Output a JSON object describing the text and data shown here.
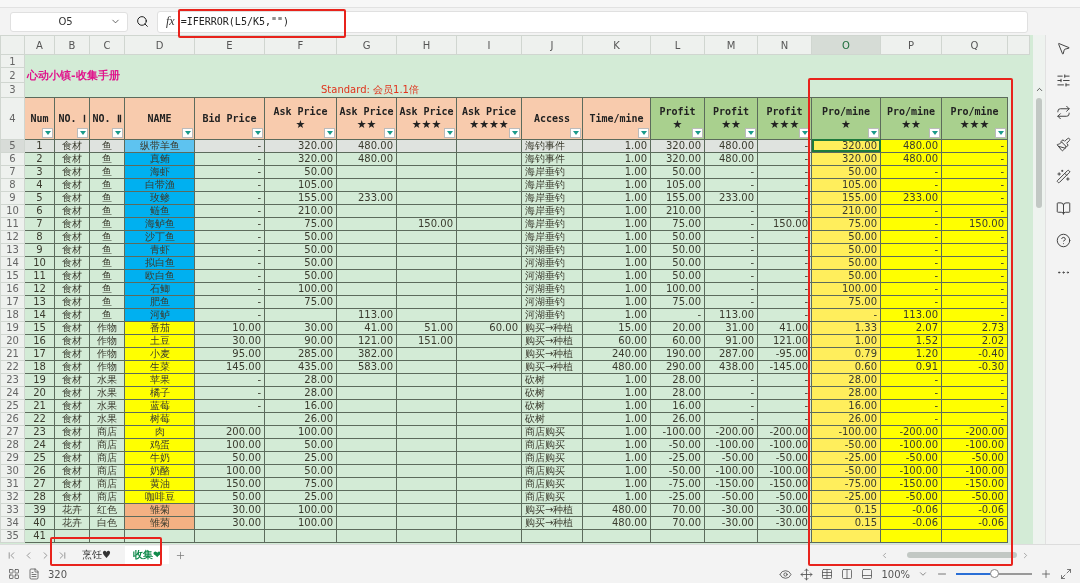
{
  "formula_bar": {
    "cell_ref": "O5",
    "function_label": "fx",
    "formula": "=IFERROR(L5/K5,\"\")"
  },
  "columns": [
    {
      "letter": "A",
      "selected": false
    },
    {
      "letter": "B",
      "selected": false
    },
    {
      "letter": "C",
      "selected": false
    },
    {
      "letter": "D",
      "selected": false
    },
    {
      "letter": "E",
      "selected": false
    },
    {
      "letter": "F",
      "selected": false
    },
    {
      "letter": "G",
      "selected": false
    },
    {
      "letter": "H",
      "selected": false
    },
    {
      "letter": "I",
      "selected": false
    },
    {
      "letter": "J",
      "selected": false
    },
    {
      "letter": "K",
      "selected": false
    },
    {
      "letter": "L",
      "selected": false
    },
    {
      "letter": "M",
      "selected": false
    },
    {
      "letter": "N",
      "selected": false
    },
    {
      "letter": "O",
      "selected": true
    },
    {
      "letter": "P",
      "selected": false
    },
    {
      "letter": "Q",
      "selected": false
    }
  ],
  "title_rows": [
    {
      "row": "1"
    },
    {
      "row": "2",
      "text": "心动小镇-收集手册"
    },
    {
      "row": "3",
      "text": "Standard: 会员1.1倍"
    }
  ],
  "header_row": {
    "row": "4",
    "cells": [
      {
        "label": "Num",
        "color": "#f8cbad"
      },
      {
        "label": "NO. Ⅰ",
        "color": "#f8cbad"
      },
      {
        "label": "NO. Ⅱ",
        "color": "#f8cbad"
      },
      {
        "label": "NAME",
        "color": "#f8cbad"
      },
      {
        "label": "Bid Price",
        "color": "#f8cbad"
      },
      {
        "label": "Ask Price",
        "sub": "★",
        "color": "#f8cbad"
      },
      {
        "label": "Ask Price",
        "sub": "★★",
        "color": "#f8cbad"
      },
      {
        "label": "Ask Price",
        "sub": "★★★",
        "color": "#f8cbad"
      },
      {
        "label": "Ask Price",
        "sub": "★★★★",
        "color": "#f8cbad"
      },
      {
        "label": "Access",
        "color": "#f8cbad"
      },
      {
        "label": "Time/mine",
        "color": "#f8cbad"
      },
      {
        "label": "Profit",
        "sub": "★",
        "color": "#a9d08e"
      },
      {
        "label": "Profit",
        "sub": "★★",
        "color": "#a9d08e"
      },
      {
        "label": "Profit",
        "sub": "★★★",
        "color": "#a9d08e"
      },
      {
        "label": "Pro/mine",
        "sub": "★",
        "color": "#a9d08e"
      },
      {
        "label": "Pro/mine",
        "sub": "★★",
        "color": "#a9d08e"
      },
      {
        "label": "Pro/mine",
        "sub": "★★★",
        "color": "#a9d08e"
      }
    ]
  },
  "rows": [
    {
      "row": "5",
      "selected": true,
      "color": "#5ec3f0",
      "cells": [
        "1",
        "食材",
        "鱼",
        "纵带羊鱼",
        "-",
        "320.00",
        "480.00",
        null,
        null,
        "海钓事件",
        "1.00",
        "320.00",
        "480.00",
        "-",
        "320.00",
        "480.00",
        "-"
      ]
    },
    {
      "row": "6",
      "selected": false,
      "color": "#00b0f0",
      "cells": [
        "2",
        "食材",
        "鱼",
        "真鲔",
        "-",
        "320.00",
        "480.00",
        null,
        null,
        "海钓事件",
        "1.00",
        "320.00",
        "480.00",
        "-",
        "320.00",
        "480.00",
        "-"
      ]
    },
    {
      "row": "7",
      "selected": false,
      "color": "#00b0f0",
      "cells": [
        "3",
        "食材",
        "鱼",
        "海虾",
        "-",
        "50.00",
        null,
        null,
        null,
        "海岸垂钓",
        "1.00",
        "50.00",
        "-",
        "-",
        "50.00",
        "-",
        "-"
      ]
    },
    {
      "row": "8",
      "selected": false,
      "color": "#00b0f0",
      "cells": [
        "4",
        "食材",
        "鱼",
        "白带渔",
        "-",
        "105.00",
        null,
        null,
        null,
        "海岸垂钓",
        "1.00",
        "105.00",
        "-",
        "-",
        "105.00",
        "-",
        "-"
      ]
    },
    {
      "row": "9",
      "selected": false,
      "color": "#00b0f0",
      "cells": [
        "5",
        "食材",
        "鱼",
        "玫鲹",
        "-",
        "155.00",
        "233.00",
        null,
        null,
        "海岸垂钓",
        "1.00",
        "155.00",
        "233.00",
        "-",
        "155.00",
        "233.00",
        "-"
      ]
    },
    {
      "row": "10",
      "selected": false,
      "color": "#00b0f0",
      "cells": [
        "6",
        "食材",
        "鱼",
        "鲢鱼",
        "-",
        "210.00",
        null,
        null,
        null,
        "海岸垂钓",
        "1.00",
        "210.00",
        "-",
        "-",
        "210.00",
        "-",
        "-"
      ]
    },
    {
      "row": "11",
      "selected": false,
      "color": "#00b0f0",
      "cells": [
        "7",
        "食材",
        "鱼",
        "海鲈鱼",
        "-",
        "75.00",
        null,
        "150.00",
        null,
        "海岸垂钓",
        "1.00",
        "75.00",
        "-",
        "150.00",
        "75.00",
        "-",
        "150.00"
      ]
    },
    {
      "row": "12",
      "selected": false,
      "color": "#00b0f0",
      "cells": [
        "8",
        "食材",
        "鱼",
        "沙丁鱼",
        "-",
        "50.00",
        null,
        null,
        null,
        "海岸垂钓",
        "1.00",
        "50.00",
        "-",
        "-",
        "50.00",
        "-",
        "-"
      ]
    },
    {
      "row": "13",
      "selected": false,
      "color": "#00b0f0",
      "cells": [
        "9",
        "食材",
        "鱼",
        "青虾",
        "-",
        "50.00",
        null,
        null,
        null,
        "河湖垂钓",
        "1.00",
        "50.00",
        "-",
        "-",
        "50.00",
        "-",
        "-"
      ]
    },
    {
      "row": "14",
      "selected": false,
      "color": "#00b0f0",
      "cells": [
        "10",
        "食材",
        "鱼",
        "拟白鱼",
        "-",
        "50.00",
        null,
        null,
        null,
        "河湖垂钓",
        "1.00",
        "50.00",
        "-",
        "-",
        "50.00",
        "-",
        "-"
      ]
    },
    {
      "row": "15",
      "selected": false,
      "color": "#00b0f0",
      "cells": [
        "11",
        "食材",
        "鱼",
        "欧白鱼",
        "-",
        "50.00",
        null,
        null,
        null,
        "河湖垂钓",
        "1.00",
        "50.00",
        "-",
        "-",
        "50.00",
        "-",
        "-"
      ]
    },
    {
      "row": "16",
      "selected": false,
      "color": "#00b0f0",
      "cells": [
        "12",
        "食材",
        "鱼",
        "石鲫",
        "-",
        "100.00",
        null,
        null,
        null,
        "河湖垂钓",
        "1.00",
        "100.00",
        "-",
        "-",
        "100.00",
        "-",
        "-"
      ]
    },
    {
      "row": "17",
      "selected": false,
      "color": "#00b0f0",
      "cells": [
        "13",
        "食材",
        "鱼",
        "肥鱼",
        "-",
        "75.00",
        null,
        null,
        null,
        "河湖垂钓",
        "1.00",
        "75.00",
        "-",
        "-",
        "75.00",
        "-",
        "-"
      ]
    },
    {
      "row": "18",
      "selected": false,
      "color": "#00b0f0",
      "cells": [
        "14",
        "食材",
        "鱼",
        "河鲈",
        "-",
        null,
        "113.00",
        null,
        null,
        "河湖垂钓",
        "1.00",
        "-",
        "113.00",
        "-",
        "-",
        "113.00",
        "-"
      ]
    },
    {
      "row": "19",
      "selected": false,
      "color": "#ffff00",
      "cells": [
        "15",
        "食材",
        "作物",
        "番茄",
        "10.00",
        "30.00",
        "41.00",
        "51.00",
        "60.00",
        "购买→种植",
        "15.00",
        "20.00",
        "31.00",
        "41.00",
        "1.33",
        "2.07",
        "2.73"
      ]
    },
    {
      "row": "20",
      "selected": false,
      "color": "#ffff00",
      "cells": [
        "16",
        "食材",
        "作物",
        "土豆",
        "30.00",
        "90.00",
        "121.00",
        "151.00",
        null,
        "购买→种植",
        "60.00",
        "60.00",
        "91.00",
        "121.00",
        "1.00",
        "1.52",
        "2.02"
      ]
    },
    {
      "row": "21",
      "selected": false,
      "color": "#ffff00",
      "cells": [
        "17",
        "食材",
        "作物",
        "小麦",
        "95.00",
        "285.00",
        "382.00",
        null,
        null,
        "购买→种植",
        "240.00",
        "190.00",
        "287.00",
        "-95.00",
        "0.79",
        "1.20",
        "-0.40"
      ]
    },
    {
      "row": "22",
      "selected": false,
      "color": "#ffff00",
      "cells": [
        "18",
        "食材",
        "作物",
        "生菜",
        "145.00",
        "435.00",
        "583.00",
        null,
        null,
        "购买→种植",
        "480.00",
        "290.00",
        "438.00",
        "-145.00",
        "0.60",
        "0.91",
        "-0.30"
      ]
    },
    {
      "row": "23",
      "selected": false,
      "color": "#ffff00",
      "cells": [
        "19",
        "食材",
        "水果",
        "苹果",
        "-",
        "28.00",
        null,
        null,
        null,
        "砍树",
        "1.00",
        "28.00",
        "-",
        "-",
        "28.00",
        "-",
        "-"
      ]
    },
    {
      "row": "24",
      "selected": false,
      "color": "#ffff00",
      "cells": [
        "20",
        "食材",
        "水果",
        "橘子",
        "-",
        "28.00",
        null,
        null,
        null,
        "砍树",
        "1.00",
        "28.00",
        "-",
        "-",
        "28.00",
        "-",
        "-"
      ]
    },
    {
      "row": "25",
      "selected": false,
      "color": "#ffff00",
      "cells": [
        "21",
        "食材",
        "水果",
        "蓝莓",
        "-",
        "16.00",
        null,
        null,
        null,
        "砍树",
        "1.00",
        "16.00",
        "-",
        "-",
        "16.00",
        "-",
        "-"
      ]
    },
    {
      "row": "26",
      "selected": false,
      "color": "#ffff00",
      "cells": [
        "22",
        "食材",
        "水果",
        "树莓",
        null,
        "26.00",
        null,
        null,
        null,
        "砍树",
        "1.00",
        "26.00",
        "-",
        "-",
        "26.00",
        "-",
        "-"
      ]
    },
    {
      "row": "27",
      "selected": false,
      "color": "#ffff00",
      "cells": [
        "23",
        "食材",
        "商店",
        "肉",
        "200.00",
        "100.00",
        null,
        null,
        null,
        "商店购买",
        "1.00",
        "-100.00",
        "-200.00",
        "-200.00",
        "-100.00",
        "-200.00",
        "-200.00"
      ]
    },
    {
      "row": "28",
      "selected": false,
      "color": "#ffff00",
      "cells": [
        "24",
        "食材",
        "商店",
        "鸡蛋",
        "100.00",
        "50.00",
        null,
        null,
        null,
        "商店购买",
        "1.00",
        "-50.00",
        "-100.00",
        "-100.00",
        "-50.00",
        "-100.00",
        "-100.00"
      ]
    },
    {
      "row": "29",
      "selected": false,
      "color": "#ffff00",
      "cells": [
        "25",
        "食材",
        "商店",
        "牛奶",
        "50.00",
        "25.00",
        null,
        null,
        null,
        "商店购买",
        "1.00",
        "-25.00",
        "-50.00",
        "-50.00",
        "-25.00",
        "-50.00",
        "-50.00"
      ]
    },
    {
      "row": "30",
      "selected": false,
      "color": "#ffff00",
      "cells": [
        "26",
        "食材",
        "商店",
        "奶酪",
        "100.00",
        "50.00",
        null,
        null,
        null,
        "商店购买",
        "1.00",
        "-50.00",
        "-100.00",
        "-100.00",
        "-50.00",
        "-100.00",
        "-100.00"
      ]
    },
    {
      "row": "31",
      "selected": false,
      "color": "#ffff00",
      "cells": [
        "27",
        "食材",
        "商店",
        "黄油",
        "150.00",
        "75.00",
        null,
        null,
        null,
        "商店购买",
        "1.00",
        "-75.00",
        "-150.00",
        "-150.00",
        "-75.00",
        "-150.00",
        "-150.00"
      ]
    },
    {
      "row": "32",
      "selected": false,
      "color": "#ffff00",
      "cells": [
        "28",
        "食材",
        "商店",
        "咖啡豆",
        "50.00",
        "25.00",
        null,
        null,
        null,
        "商店购买",
        "1.00",
        "-25.00",
        "-50.00",
        "-50.00",
        "-25.00",
        "-50.00",
        "-50.00"
      ]
    },
    {
      "row": "33",
      "selected": false,
      "color": "#f4b183",
      "cells": [
        "39",
        "花卉",
        "红色",
        "雏菊",
        "30.00",
        "100.00",
        null,
        null,
        null,
        "购买→种植",
        "480.00",
        "70.00",
        "-30.00",
        "-30.00",
        "0.15",
        "-0.06",
        "-0.06"
      ]
    },
    {
      "row": "34",
      "selected": false,
      "color": "#f4b183",
      "cells": [
        "40",
        "花卉",
        "白色",
        "雏菊",
        "30.00",
        "100.00",
        null,
        null,
        null,
        "购买→种植",
        "480.00",
        "70.00",
        "-30.00",
        "-30.00",
        "0.15",
        "-0.06",
        "-0.06"
      ]
    },
    {
      "row": "35",
      "selected": false,
      "cells": [
        "41"
      ]
    }
  ],
  "sheet_tabs": [
    {
      "label": "烹饪♥",
      "selected": false
    },
    {
      "label": "收集❤",
      "selected": true
    }
  ],
  "status_bar": {
    "page_count": "320",
    "zoom_label": "100%",
    "zoom": {
      "level": 0.5
    }
  }
}
